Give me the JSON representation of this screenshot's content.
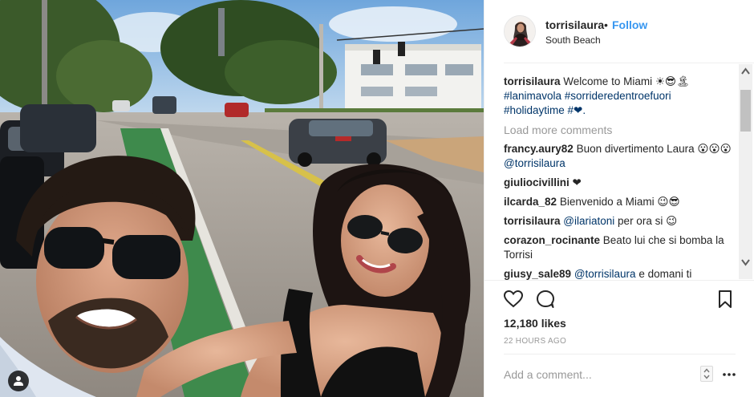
{
  "post": {
    "username": "torrisilaura",
    "separator": "•",
    "follow_label": "Follow",
    "location": "South Beach"
  },
  "caption": {
    "username": "torrisilaura",
    "text": "Welcome to Miami ☀😎🏝",
    "hashtags_line1": "#lanimavola #sorrideredentroefuori",
    "hashtags_line2": "#holidaytime #❤."
  },
  "load_more_label": "Load more comments",
  "comments": [
    {
      "user": "francy.aury82",
      "text": "Buon divertimento Laura 😮😮😮",
      "mention": "@torrisilaura",
      "after": ""
    },
    {
      "user": "giuliocivillini",
      "text": "❤",
      "mention": "",
      "after": ""
    },
    {
      "user": "ilcarda_82",
      "text": "Bienvenido a Miami 😉😎",
      "mention": "",
      "after": ""
    },
    {
      "user": "torrisilaura",
      "text": "",
      "mention": "@ilariatoni",
      "after": "per ora si 😉"
    },
    {
      "user": "corazon_rocinante",
      "text": "Beato lui che si bomba la Torrisi",
      "mention": "",
      "after": ""
    },
    {
      "user": "giusy_sale89",
      "text": "",
      "mention": "@torrisilaura",
      "after": "e domani ti"
    }
  ],
  "icons": {
    "like": "heart-outline-icon",
    "comment": "speech-bubble-icon",
    "save": "bookmark-icon",
    "more": "ellipsis-icon",
    "user_tag": "person-icon"
  },
  "likes_text": "12,180 likes",
  "timestamp": "22 HOURS AGO",
  "add_comment_placeholder": "Add a comment...",
  "colors": {
    "link": "#003569",
    "follow": "#3897f0",
    "muted": "#999999",
    "text": "#262626"
  }
}
